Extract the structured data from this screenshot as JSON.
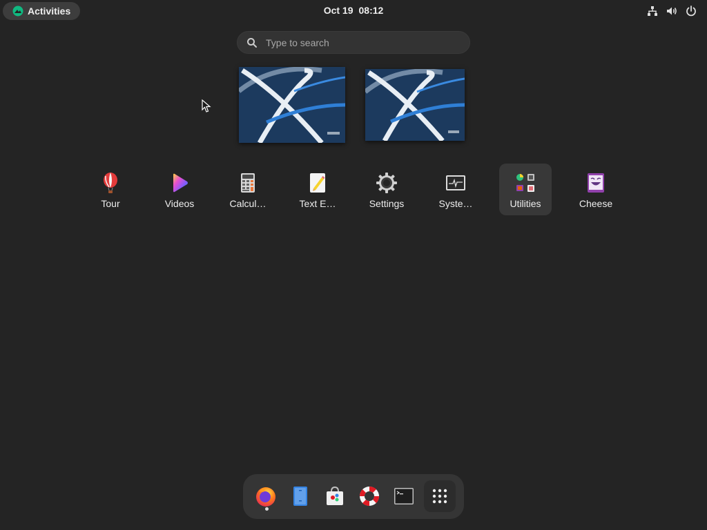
{
  "topbar": {
    "activities_label": "Activities",
    "date": "Oct 19",
    "time": "08:12",
    "tray_icons": [
      "network-icon",
      "volume-icon",
      "power-icon"
    ]
  },
  "search": {
    "placeholder": "Type to search"
  },
  "workspaces": [
    {
      "name": "workspace-1",
      "active": true
    },
    {
      "name": "workspace-2",
      "active": false
    }
  ],
  "apps": [
    {
      "label": "Tour",
      "icon": "tour-balloon-icon"
    },
    {
      "label": "Videos",
      "icon": "videos-play-icon"
    },
    {
      "label": "Calcul…",
      "icon": "calculator-icon"
    },
    {
      "label": "Text E…",
      "icon": "text-editor-icon"
    },
    {
      "label": "Settings",
      "icon": "settings-gear-icon"
    },
    {
      "label": "Syste…",
      "icon": "system-monitor-icon"
    },
    {
      "label": "Utilities",
      "icon": "utilities-folder-icon",
      "selected": true
    },
    {
      "label": "Cheese",
      "icon": "cheese-icon"
    }
  ],
  "dock": {
    "items": [
      {
        "name": "firefox",
        "icon": "firefox-icon",
        "running": true
      },
      {
        "name": "files",
        "icon": "files-icon"
      },
      {
        "name": "software",
        "icon": "software-store-icon"
      },
      {
        "name": "help",
        "icon": "help-lifebuoy-icon"
      },
      {
        "name": "terminal",
        "icon": "terminal-icon"
      },
      {
        "name": "show-apps",
        "icon": "app-grid-icon"
      }
    ]
  },
  "colors": {
    "background": "#242424",
    "panel": "#3d3d3d",
    "dock": "#353535",
    "selected_tile": "#383838"
  }
}
